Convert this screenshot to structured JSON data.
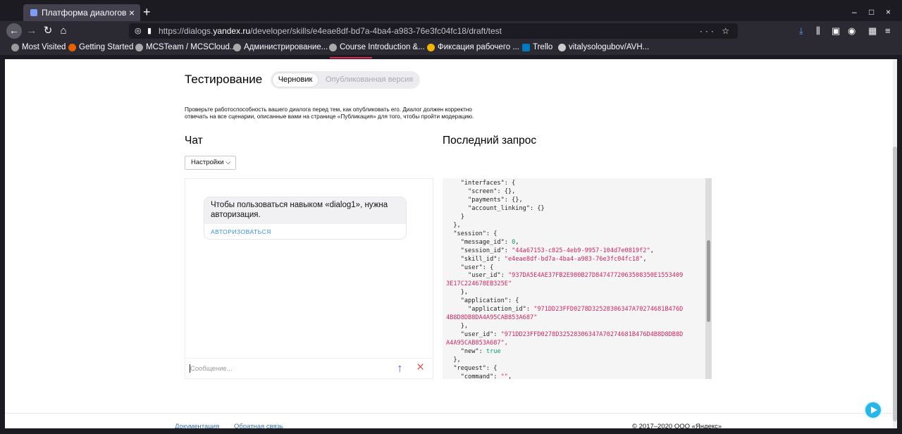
{
  "browser": {
    "tab_title": "Платформа диалогов",
    "url_prefix": "https://dialogs.",
    "url_host": "yandex.ru",
    "url_path": "/developer/skills/e4eae8df-bd7a-4ba4-a983-76e3fc04fc18/draft/test",
    "bookmarks": [
      {
        "label": "Most Visited",
        "color": "#9a9a9a"
      },
      {
        "label": "Getting Started",
        "color": "#e66000"
      },
      {
        "label": "MCSTeam / MCSCloud...",
        "color": "#aaaaaa"
      },
      {
        "label": "Администрирование...",
        "color": "#aaaaaa"
      },
      {
        "label": "Course Introduction &...",
        "color": "#aaaaaa"
      },
      {
        "label": "Фиксация рабочего ...",
        "color": "#f4b400"
      },
      {
        "label": "Trello",
        "color": "#0079bf"
      },
      {
        "label": "vitalysologubov/AVH...",
        "color": "#cccccc"
      }
    ]
  },
  "page": {
    "title": "Тестирование",
    "toggle_active": "Черновик",
    "toggle_inactive": "Опубликованная версия",
    "description_line1": "Проверьте работоспособность вашего диалога перед тем, как опубликовать его. Диалог должен корректно",
    "description_line2": "отвечать на все сценарии, описанные вами на странице «Публикация» для того, чтобы пройти модерацию.",
    "chat_heading": "Чат",
    "request_heading": "Последний запрос",
    "settings_label": "Настройки",
    "chat_message": "Чтобы пользоваться навыком «dialog1», нужна авторизация.",
    "chat_action": "АВТОРИЗОВАТЬСЯ",
    "message_placeholder": "Сообщение...",
    "footer_docs": "Документация",
    "footer_feedback": "Обратная связь",
    "footer_copyright": "© 2017–2020 ООО «Яндекс»"
  },
  "request_json_lines": [
    "    \"interfaces\": {",
    "      \"screen\": {},",
    "      \"payments\": {},",
    "      \"account_linking\": {}",
    "    }",
    "  },",
    "  \"session\": {",
    "    \"message_id\": 0,",
    "    \"session_id\": \"44a67153-c825-4eb9-9957-104d7e0819f2\",",
    "    \"skill_id\": \"e4eae8df-bd7a-4ba4-a983-76e3fc04fc18\",",
    "    \"user\": {",
    "      \"user_id\": \"937DA5E4AE37FB2E980B27D8474772063508350E1553409",
    "3E17C224678EB325E\"",
    "    },",
    "    \"application\": {",
    "      \"application_id\": \"971DD23FFD0278D32528306347A70274681B476D",
    "4B8D8DB8DA4A95CAB853A687\"",
    "    },",
    "    \"user_id\": \"971DD23FFD0278D32528306347A70274681B476D4B8D8DB8D",
    "A4A95CAB853A687\",",
    "    \"new\": true",
    "  },",
    "  \"request\": {",
    "    \"command\": \"\","
  ]
}
